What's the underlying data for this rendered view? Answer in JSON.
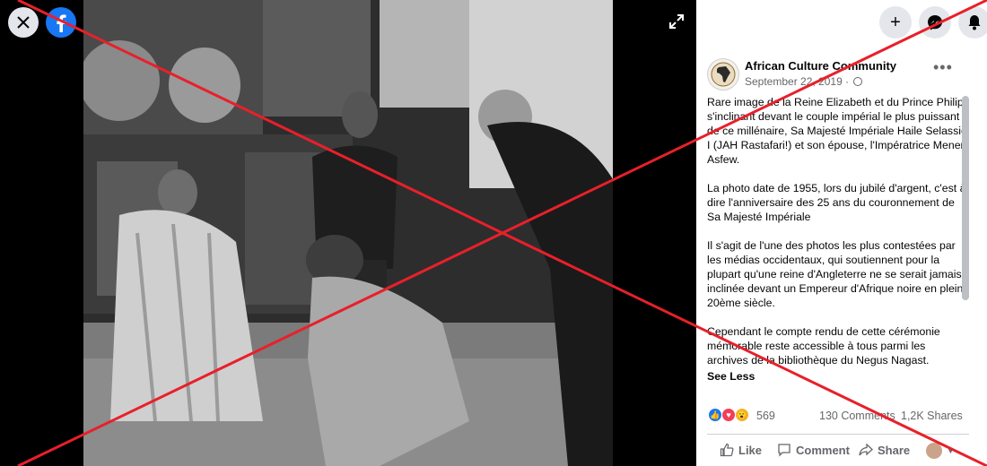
{
  "viewer": {
    "close_icon": "close-icon",
    "logo_icon": "facebook-logo-icon",
    "expand_icon": "expand-icon",
    "photo_alt": ""
  },
  "header": {
    "buttons": [
      {
        "icon": "plus-icon",
        "glyph": "+"
      },
      {
        "icon": "messenger-icon"
      },
      {
        "icon": "notifications-bell-icon"
      }
    ]
  },
  "post": {
    "page_name": "African Culture Community",
    "date": "September 22, 2019 · ",
    "paragraphs": [
      "Rare image de la Reine Elizabeth et du Prince Philip s'inclinant devant le couple impérial le plus puissant de ce millénaire, Sa Majesté Impériale Haile Selassie I (JAH Rastafari!) et son épouse, l'Impératrice Menen Asfew.",
      "La photo date de 1955, lors du jubilé d'argent, c'est à dire l'anniversaire des 25 ans du couronnement de Sa Majesté Impériale",
      "Il s'agit de l'une des photos les plus contestées par les médias occidentaux, qui soutiennent pour la plupart qu'une reine d'Angleterre ne se serait jamais inclinée devant un Empereur d'Afrique noire en plein 20ème siècle.",
      "Cependant le compte rendu de cette cérémonie mémorable reste accessible à tous parmi les archives de la bibliothèque du Negus Nagast."
    ],
    "see_less": "See Less",
    "reactions_count": "569",
    "comments": "130 Comments",
    "shares": "1,2K Shares",
    "actions": {
      "like": "Like",
      "comment": "Comment",
      "share": "Share"
    }
  },
  "overlay": {
    "cross_color": "#e8202a"
  },
  "colors": {
    "facebook_blue": "#1877f2",
    "text_secondary": "#65676b"
  }
}
